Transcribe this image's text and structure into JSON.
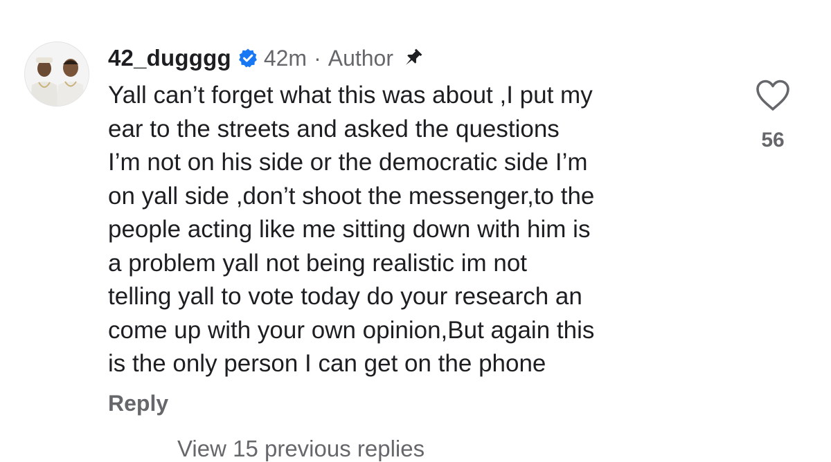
{
  "comment": {
    "username": "42_dugggg",
    "verified_icon": "verified-badge-icon",
    "time": "42m",
    "separator": "·",
    "author_label": "Author",
    "pin_icon": "pin-icon",
    "text": "Yall can’t forget what this was about ,I put my\near to the streets and asked the questions\nI’m not on his side or the democratic side I’m\non yall side ,don’t shoot the messenger,to the\npeople acting like me sitting down with him is\na problem yall not being realistic im not\ntelling yall to vote today do your research an\ncome up with your own opinion,But again this\nis the only person I can get on the phone",
    "reply_label": "Reply",
    "like_icon": "heart-outline-icon",
    "like_count": "56"
  },
  "view_replies_label": "View 15 previous replies",
  "colors": {
    "text": "#1c1e21",
    "secondary": "#65676b",
    "verified_blue": "#1877f2",
    "background": "#ffffff"
  }
}
